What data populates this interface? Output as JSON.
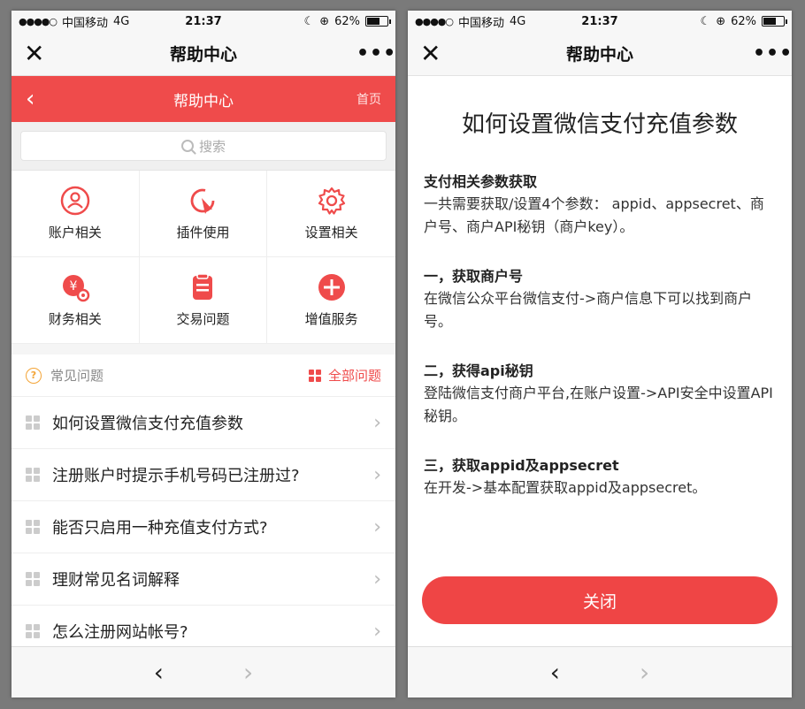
{
  "status": {
    "carrier": "中国移动",
    "network": "4G",
    "time": "21:37",
    "battery": "62%",
    "battery_level": 0.62
  },
  "wx_nav": {
    "title": "帮助中心",
    "more": "•••",
    "close": "✕"
  },
  "header": {
    "title": "帮助中心",
    "home": "首页"
  },
  "search": {
    "placeholder": "搜索"
  },
  "categories": [
    {
      "label": "账户相关",
      "icon": "user-circle-icon"
    },
    {
      "label": "插件使用",
      "icon": "pointer-refresh-icon"
    },
    {
      "label": "设置相关",
      "icon": "gear-icon"
    },
    {
      "label": "财务相关",
      "icon": "yuan-gear-icon"
    },
    {
      "label": "交易问题",
      "icon": "clipboard-icon"
    },
    {
      "label": "增值服务",
      "icon": "plus-circle-icon"
    }
  ],
  "faq": {
    "title": "常见问题",
    "all_label": "全部问题",
    "items": [
      "如何设置微信支付充值参数",
      "注册账户时提示手机号码已注册过?",
      "能否只启用一种充值支付方式?",
      "理财常见名词解释",
      "怎么注册网站帐号?"
    ]
  },
  "article": {
    "title": "如何设置微信支付充值参数",
    "sections": [
      {
        "heading": "支付相关参数获取",
        "body": "一共需要获取/设置4个参数： appid、appsecret、商户号、商户API秘钥（商户key）。"
      },
      {
        "heading": "一，获取商户号",
        "body": "在微信公众平台微信支付->商户信息下可以找到商户号。"
      },
      {
        "heading": "二，获得api秘钥",
        "body": "登陆微信支付商户平台,在账户设置->API安全中设置API秘钥。"
      },
      {
        "heading": "三，获取appid及appsecret",
        "body": "在开发->基本配置获取appid及appsecret。"
      }
    ],
    "close_label": "关闭"
  },
  "colors": {
    "accent": "#ef4b4b",
    "icon_red": "#ef4b4b",
    "faq_bullet": "#cccccc",
    "question_icon": "#f3a436"
  }
}
